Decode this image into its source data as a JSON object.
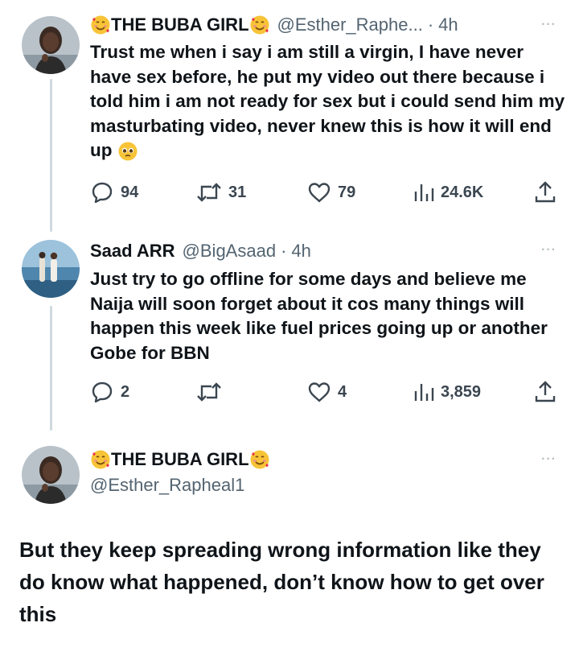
{
  "tweet1": {
    "name": "THE BUBA GIRL",
    "handle": "@Esther_Raphe...",
    "time": "4h",
    "text": "Trust me when i say i am still a virgin, I have never have sex before, he put my video out there because i told him i am not ready for sex but i could send him my masturbating video, never knew this is how it will end up",
    "replies": "94",
    "retweets": "31",
    "likes": "79",
    "views": "24.6K"
  },
  "tweet2": {
    "name": "Saad ARR",
    "handle": "@BigAsaad",
    "time": "4h",
    "text": "Just try to go offline for some days and believe me Naija will soon forget about it cos many things will happen this week like fuel prices going up or another Gobe for BBN",
    "replies": "2",
    "retweets": "",
    "likes": "4",
    "views": "3,859"
  },
  "tweet3": {
    "name": "THE BUBA GIRL",
    "handle": "@Esther_Rapheal1",
    "text": "But they keep spreading wrong information like they do know what happened, don’t know how to get over this"
  },
  "colors": {
    "text": "#0f1419",
    "secondary": "#536471",
    "thread_line": "#cfd9de"
  },
  "icons": [
    "smiling-face-with-hearts-emoji",
    "pleading-face-emoji",
    "reply-icon",
    "retweet-icon",
    "like-icon",
    "views-icon",
    "share-icon",
    "more-icon"
  ],
  "separators": {
    "dot": "·",
    "more": "···"
  }
}
